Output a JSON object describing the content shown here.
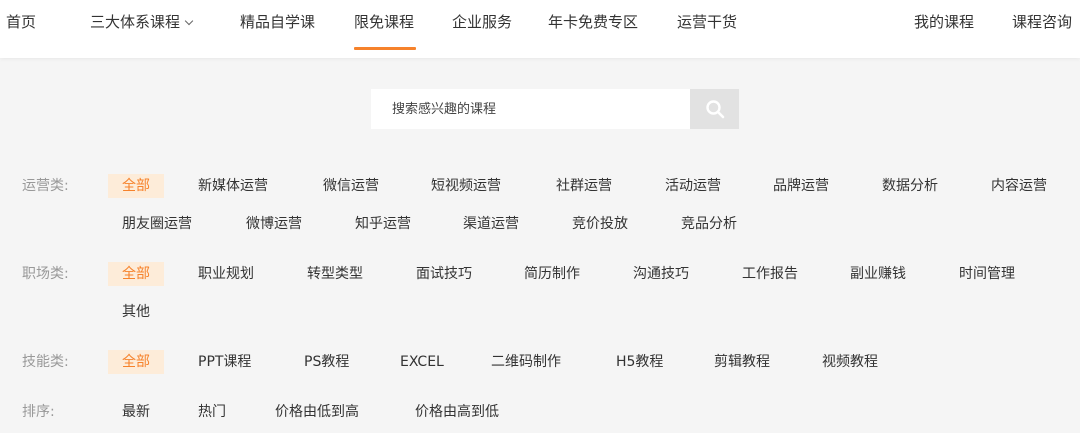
{
  "nav": {
    "home": "首页",
    "systems": "三大体系课程",
    "selfstudy": "精品自学课",
    "free": "限免课程",
    "enterprise": "企业服务",
    "annual": "年卡免费专区",
    "ops": "运营干货",
    "mycourses": "我的课程",
    "consult": "课程咨询"
  },
  "search": {
    "placeholder": "搜索感兴趣的课程"
  },
  "filters": {
    "operations": {
      "label": "运营类:",
      "tags": [
        "全部",
        "新媒体运营",
        "微信运营",
        "短视频运营",
        "社群运营",
        "活动运营",
        "品牌运营",
        "数据分析",
        "内容运营",
        "朋友圈运营",
        "微博运营",
        "知乎运营",
        "渠道运营",
        "竞价投放",
        "竞品分析"
      ]
    },
    "career": {
      "label": "职场类:",
      "tags": [
        "全部",
        "职业规划",
        "转型类型",
        "面试技巧",
        "简历制作",
        "沟通技巧",
        "工作报告",
        "副业赚钱",
        "时间管理",
        "其他"
      ]
    },
    "skills": {
      "label": "技能类:",
      "tags": [
        "全部",
        "PPT课程",
        "PS教程",
        "EXCEL",
        "二维码制作",
        "H5教程",
        "剪辑教程",
        "视频教程"
      ]
    },
    "sort": {
      "label": "排序:",
      "tags": [
        "最新",
        "热门",
        "价格由低到高",
        "价格由高到低"
      ]
    }
  },
  "colors": {
    "accent": "#f6822b",
    "active_bg": "#fdecd9",
    "label": "#999999"
  },
  "icons": {
    "search": "search-icon",
    "dropdown": "chevron-down-icon"
  }
}
